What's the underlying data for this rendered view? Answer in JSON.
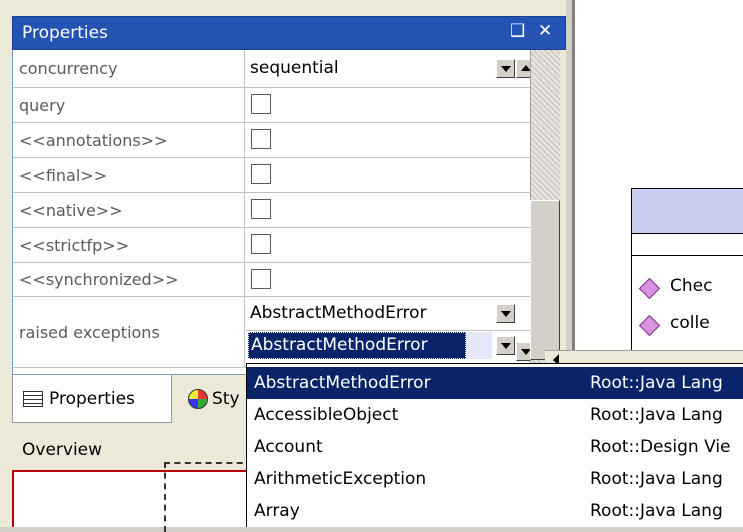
{
  "panel": {
    "title": "Properties",
    "pin_glyph": "❑",
    "close_glyph": "✕"
  },
  "properties": [
    {
      "name": "concurrency",
      "value": "sequential",
      "kind": "dropdown"
    },
    {
      "name": "query",
      "checked": false,
      "kind": "checkbox"
    },
    {
      "name": "<<annotations>>",
      "checked": false,
      "kind": "checkbox"
    },
    {
      "name": "<<final>>",
      "checked": false,
      "kind": "checkbox"
    },
    {
      "name": "<<native>>",
      "checked": false,
      "kind": "checkbox"
    },
    {
      "name": "<<strictfp>>",
      "checked": false,
      "kind": "checkbox"
    },
    {
      "name": "<<synchronized>>",
      "checked": false,
      "kind": "checkbox"
    },
    {
      "name": "raised exceptions",
      "values": [
        "AbstractMethodError",
        "AbstractMethodError"
      ],
      "kind": "list"
    }
  ],
  "tabs": [
    {
      "label": "Properties",
      "icon": "properties-icon",
      "active": true
    },
    {
      "label": "Sty",
      "icon": "styles-icon",
      "active": false
    }
  ],
  "overview": {
    "label": "Overview"
  },
  "canvas": {
    "class_items": [
      "Chec",
      "colle"
    ]
  },
  "dropdown": {
    "options": [
      {
        "name": "AbstractMethodError",
        "path": "Root::Java Lang",
        "selected": true
      },
      {
        "name": "AccessibleObject",
        "path": "Root::Java Lang",
        "selected": false
      },
      {
        "name": "Account",
        "path": "Root::Design Vie",
        "selected": false
      },
      {
        "name": "ArithmeticException",
        "path": "Root::Java Lang",
        "selected": false
      },
      {
        "name": "Array",
        "path": "Root::Java Lang",
        "selected": false
      }
    ]
  },
  "colors": {
    "titlebar": "#2354b4",
    "selection": "#0a246a",
    "class_header": "#c6cdef",
    "operation_icon": "#d892e0"
  }
}
